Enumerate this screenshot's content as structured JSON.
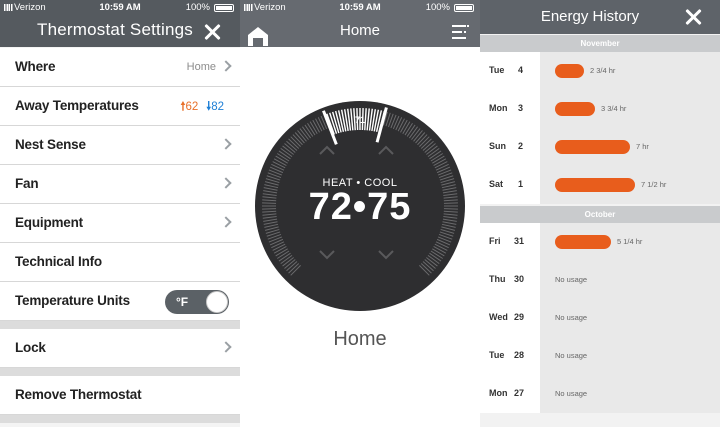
{
  "colors": {
    "header_dark": "#555a5f",
    "heat_orange": "#e8702a",
    "cool_blue": "#1d7fd6",
    "usage_bar": "#e85d1c",
    "dial_bg": "#2f2f31"
  },
  "settings_screen": {
    "status": {
      "carrier": "Verizon",
      "time": "10:59 AM",
      "battery": "100%"
    },
    "title": "Thermostat Settings",
    "close_icon": "close-icon",
    "rows": {
      "where": {
        "label": "Where",
        "value": "Home"
      },
      "away": {
        "label": "Away Temperatures",
        "heat": "62",
        "cool": "82",
        "heat_arrow": "🠕",
        "cool_arrow": "🠗"
      },
      "nest_sense": {
        "label": "Nest Sense"
      },
      "fan": {
        "label": "Fan"
      },
      "equipment": {
        "label": "Equipment"
      },
      "technical_info": {
        "label": "Technical Info"
      },
      "temperature_units": {
        "label": "Temperature Units",
        "toggle": "°F",
        "toggle_on": true
      },
      "lock": {
        "label": "Lock"
      },
      "remove": {
        "label": "Remove Thermostat"
      }
    }
  },
  "thermostat_screen": {
    "status": {
      "carrier": "Verizon",
      "time": "10:59 AM",
      "battery": "100%"
    },
    "title": "Home",
    "mode": "HEAT • COOL",
    "setpoint": "72•75",
    "heat_setpoint": 72,
    "cool_setpoint": 75,
    "ambient": "71",
    "structure_name": "Home",
    "icons": [
      "home-icon",
      "menu-icon",
      "chevron-up-icon",
      "chevron-down-icon"
    ]
  },
  "energy_screen": {
    "title": "Energy History",
    "close_icon": "close-icon",
    "months": {
      "november": "November",
      "october": "October"
    },
    "days": [
      {
        "day": "Tue",
        "date": "4",
        "hours": 2.75,
        "label": "2 3/4 hr",
        "icon": ""
      },
      {
        "day": "Mon",
        "date": "3",
        "hours": 3.75,
        "label": "3 3/4 hr",
        "icon": ""
      },
      {
        "day": "Sun",
        "date": "2",
        "hours": 7,
        "label": "7 hr",
        "icon": "weather-icon"
      },
      {
        "day": "Sat",
        "date": "1",
        "hours": 7.5,
        "label": "7 1/2 hr",
        "icon": "weather-icon"
      },
      {
        "day": "Fri",
        "date": "31",
        "hours": 5.25,
        "label": "5 1/4 hr",
        "icon": ""
      },
      {
        "day": "Thu",
        "date": "30",
        "hours": 0,
        "label": "No usage",
        "icon": ""
      },
      {
        "day": "Wed",
        "date": "29",
        "hours": 0,
        "label": "No usage",
        "icon": ""
      },
      {
        "day": "Tue",
        "date": "28",
        "hours": 0,
        "label": "No usage",
        "icon": "away-icon"
      },
      {
        "day": "Mon",
        "date": "27",
        "hours": 0,
        "label": "No usage",
        "icon": "away-icon"
      }
    ]
  }
}
